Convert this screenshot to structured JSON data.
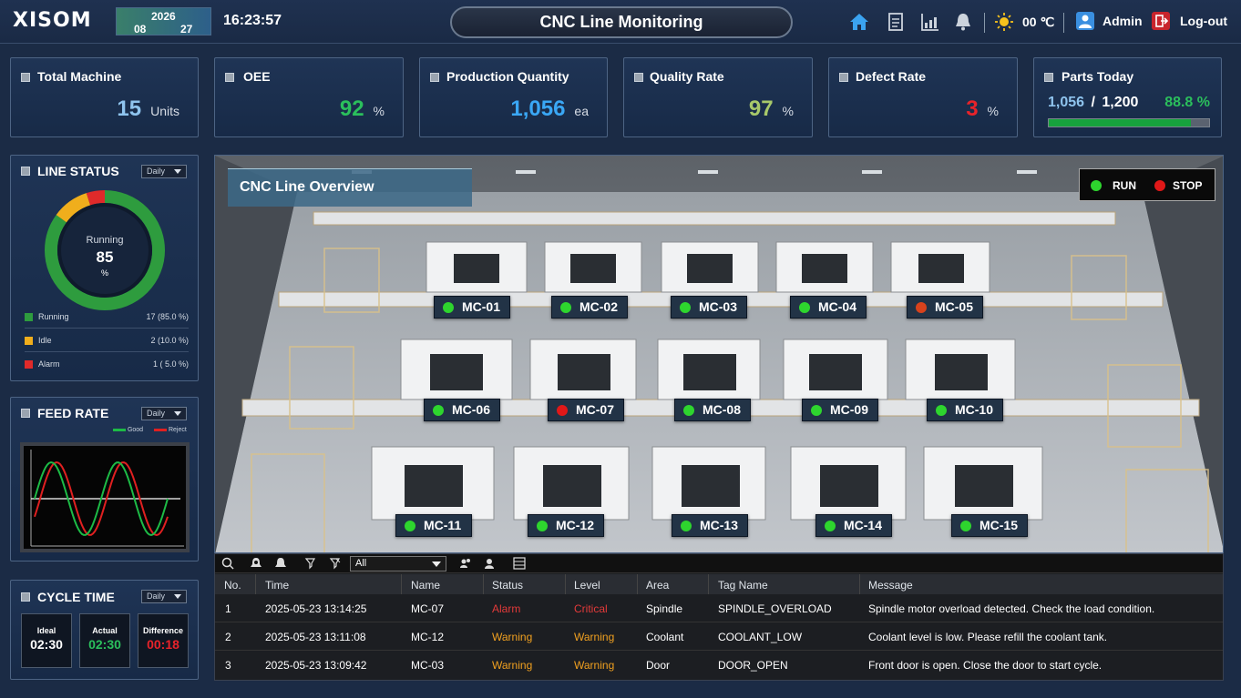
{
  "header": {
    "logo": "XISOM",
    "date": {
      "year": "2026",
      "month": "08",
      "day": "27"
    },
    "time": "16:23:57",
    "title": "CNC Line Monitoring",
    "temperature": "00 ℃",
    "user": "Admin",
    "logout": "Log-out"
  },
  "kpis": [
    {
      "title": "Total Machine",
      "value": "15",
      "unit": "Units",
      "color": "#8fc4ee"
    },
    {
      "title": "OEE",
      "value": "92",
      "unit": "%",
      "color": "#2bbf5c"
    },
    {
      "title": "Production Quantity",
      "value": "1,056",
      "unit": "ea",
      "color": "#3aa7f5"
    },
    {
      "title": "Quality Rate",
      "value": "97",
      "unit": "%",
      "color": "#a8c96a"
    },
    {
      "title": "Defect Rate",
      "value": "3",
      "unit": "%",
      "color": "#e8232a"
    }
  ],
  "parts": {
    "title": "Parts Today",
    "current": "1,056",
    "separator": "/",
    "target": "1,200",
    "percent": "88.8 %",
    "progress": 0.888
  },
  "line_status": {
    "title": "LINE STATUS",
    "period": "Daily",
    "center_label": "Running",
    "center_value": "85",
    "center_unit": "%",
    "items": [
      {
        "label": "Running",
        "value": "17 (85.0 %)",
        "color": "#2e9c3e",
        "pct": 85
      },
      {
        "label": "Idle",
        "value": "2 (10.0 %)",
        "color": "#f0ae1c",
        "pct": 10
      },
      {
        "label": "Alarm",
        "value": "1 ( 5.0 %)",
        "color": "#e02a2a",
        "pct": 5
      }
    ]
  },
  "feed_rate": {
    "title": "FEED RATE",
    "period": "Daily",
    "legend_good": "Good",
    "legend_reject": "Reject",
    "good_color": "#1dbb46",
    "reject_color": "#e02020"
  },
  "cycle_time": {
    "title": "CYCLE TIME",
    "period": "Daily",
    "ideal_label": "Ideal",
    "ideal": "02:30",
    "actual_label": "Actual",
    "actual": "02:30",
    "diff_label": "Difference",
    "diff": "00:18"
  },
  "overview": {
    "title": "CNC Line Overview",
    "run": "RUN",
    "stop": "STOP",
    "machines": [
      {
        "name": "MC-01",
        "status": "run"
      },
      {
        "name": "MC-02",
        "status": "run"
      },
      {
        "name": "MC-03",
        "status": "run"
      },
      {
        "name": "MC-04",
        "status": "run"
      },
      {
        "name": "MC-05",
        "status": "stop"
      },
      {
        "name": "MC-06",
        "status": "run"
      },
      {
        "name": "MC-07",
        "status": "stop"
      },
      {
        "name": "MC-08",
        "status": "run"
      },
      {
        "name": "MC-09",
        "status": "run"
      },
      {
        "name": "MC-10",
        "status": "run"
      },
      {
        "name": "MC-11",
        "status": "run"
      },
      {
        "name": "MC-12",
        "status": "run"
      },
      {
        "name": "MC-13",
        "status": "run"
      },
      {
        "name": "MC-14",
        "status": "run"
      },
      {
        "name": "MC-15",
        "status": "run"
      }
    ]
  },
  "alarms": {
    "filter": "All",
    "columns": [
      "No.",
      "Time",
      "Name",
      "Status",
      "Level",
      "Area",
      "Tag Name",
      "Message"
    ],
    "rows": [
      {
        "no": "1",
        "time": "2025-05-23 13:14:25",
        "name": "MC-07",
        "status": "Alarm",
        "level": "Critical",
        "area": "Spindle",
        "tag": "SPINDLE_OVERLOAD",
        "message": "Spindle motor overload detected. Check the load condition.",
        "color": "#e33a3a"
      },
      {
        "no": "2",
        "time": "2025-05-23 13:11:08",
        "name": "MC-12",
        "status": "Warning",
        "level": "Warning",
        "area": "Coolant",
        "tag": "COOLANT_LOW",
        "message": "Coolant level is low. Please refill the coolant tank.",
        "color": "#f0a020"
      },
      {
        "no": "3",
        "time": "2025-05-23 13:09:42",
        "name": "MC-03",
        "status": "Warning",
        "level": "Warning",
        "area": "Door",
        "tag": "DOOR_OPEN",
        "message": "Front door is open. Close the door to start cycle.",
        "color": "#f0a020"
      }
    ]
  }
}
